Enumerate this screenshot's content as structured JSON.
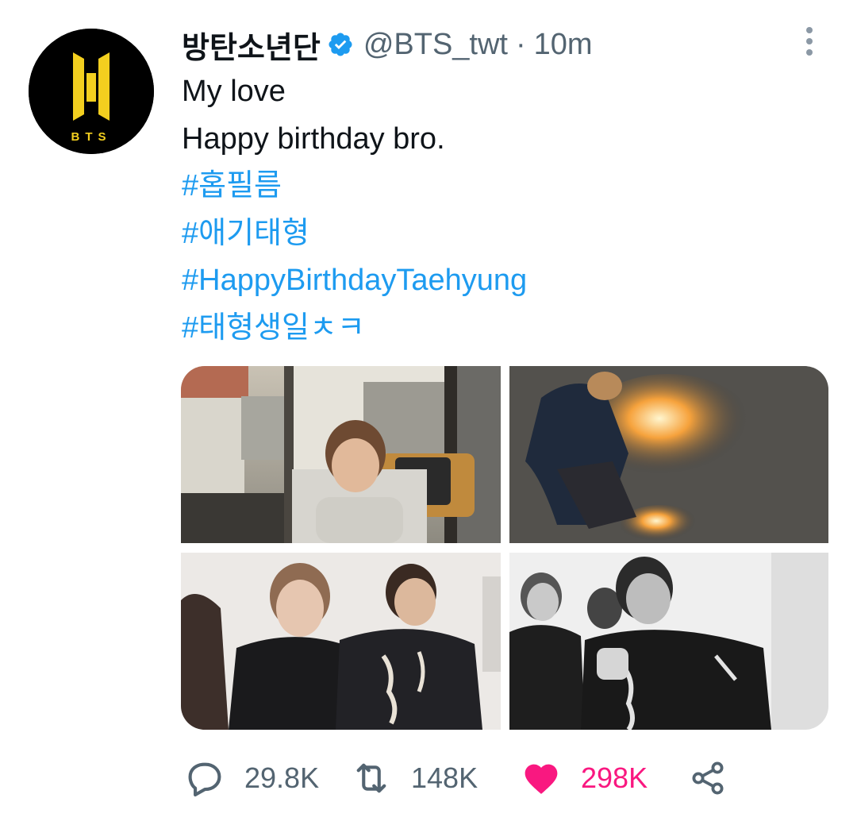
{
  "tweet": {
    "author": {
      "display_name": "방탄소년단",
      "handle": "@BTS_twt",
      "verified": true,
      "avatar_text": "BTS"
    },
    "separator": "·",
    "time": "10m",
    "lines": [
      {
        "kind": "text",
        "value": "My love"
      },
      {
        "kind": "text",
        "value": "Happy birthday bro."
      },
      {
        "kind": "hashtag",
        "value": "#홉필름"
      },
      {
        "kind": "hashtag",
        "value": "#애기태형"
      },
      {
        "kind": "hashtag",
        "value": "#HappyBirthdayTaehyung"
      },
      {
        "kind": "hashtag",
        "value": "#태형생일ㅊㅋ"
      }
    ],
    "media": {
      "count": 4
    },
    "actions": {
      "reply_count": "29.8K",
      "retweet_count": "148K",
      "like_count": "298K",
      "liked": true
    }
  },
  "colors": {
    "text": "#0f1419",
    "secondary": "#536471",
    "link": "#1d9bf0",
    "like": "#f91880",
    "logo_yellow": "#f3cf1f"
  },
  "icons": {
    "verified": "verified-badge-icon",
    "more": "more-vertical-icon",
    "reply": "reply-bubble-icon",
    "retweet": "retweet-icon",
    "like": "heart-filled-icon",
    "share": "share-icon"
  }
}
